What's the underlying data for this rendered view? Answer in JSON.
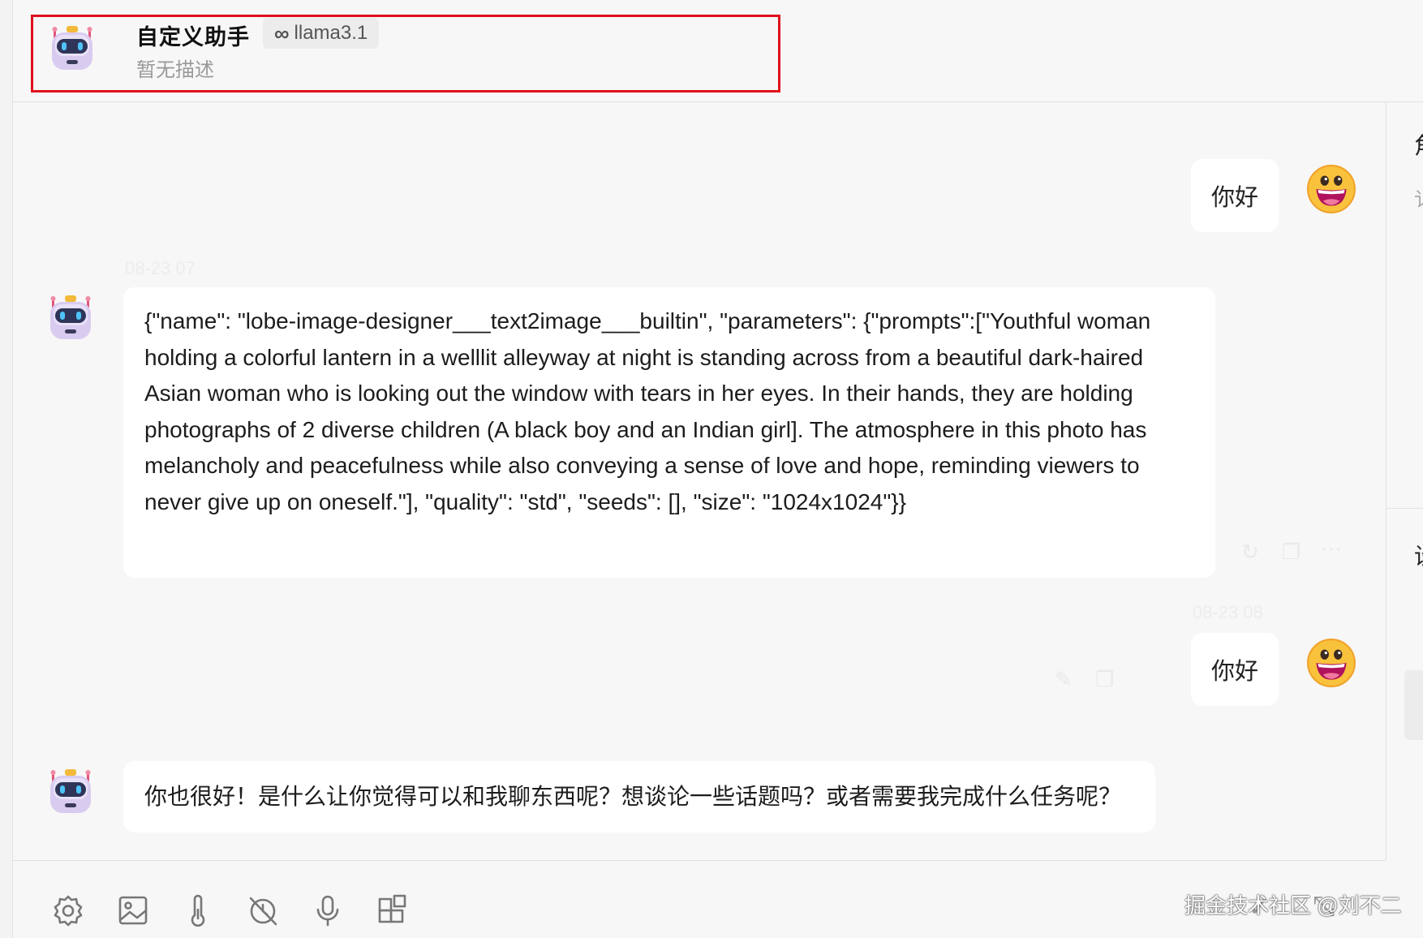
{
  "header": {
    "title": "自定义助手",
    "model": "llama3.1",
    "description": "暂无描述"
  },
  "messages": [
    {
      "role": "user",
      "text": "你好"
    },
    {
      "role": "assistant",
      "text": "{\"name\": \"lobe-image-designer___text2image___builtin\", \"parameters\": {\"prompts\":[\"Youthful woman holding a colorful lantern in a welllit alleyway at night is standing across from a beautiful dark-haired Asian woman who is looking out the window with tears in her eyes. In their hands, they are holding photographs of 2 diverse children (A black boy and an Indian girl]. The atmosphere in this photo has melancholy and peacefulness while also conveying a sense of love and hope, reminding viewers to never give up on oneself.\"], \"quality\": \"std\", \"seeds\": [], \"size\": \"1024x1024\"}}"
    },
    {
      "role": "user",
      "text": "你好"
    },
    {
      "role": "assistant",
      "text": "你也很好！是什么让你觉得可以和我聊东西呢？想谈论一些话题吗？或者需要我完成什么任务呢？"
    }
  ],
  "timestamps": [
    "08-23 07",
    "08-23 08"
  ],
  "right_panel": {
    "glyph_top": "角",
    "glyph_mid": "讠",
    "glyph_low": "设"
  },
  "toolbar": {
    "icons": [
      "settings-icon",
      "image-icon",
      "temperature-icon",
      "history-off-icon",
      "microphone-icon",
      "plugins-icon"
    ]
  },
  "watermark": "掘金技术社区 @刘不二",
  "colors": {
    "highlight": "#e0101d",
    "background": "#f7f7f7",
    "bubble": "#ffffff"
  }
}
